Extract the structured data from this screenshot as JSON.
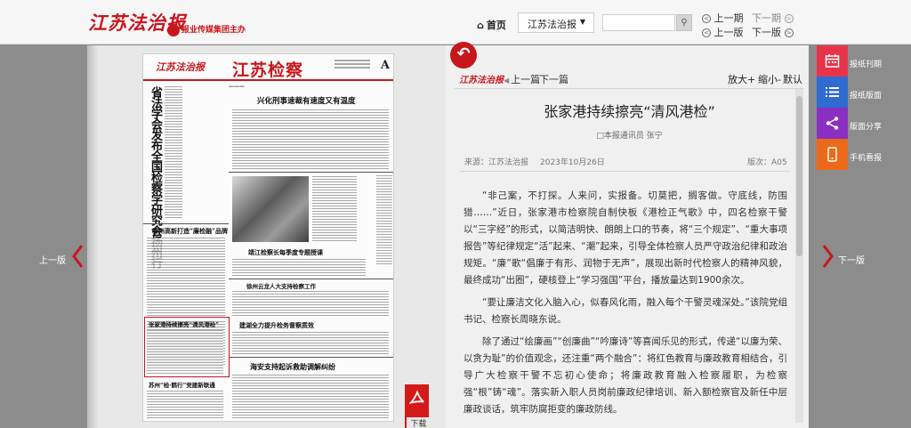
{
  "header": {
    "logo": "江苏法治报",
    "slogan": "报业传媒集团主办",
    "home_label": "首页",
    "paper_select": "江苏法治报",
    "search_placeholder": "",
    "prev_issue": "上一期",
    "next_issue": "下一期",
    "prev_page": "上一版",
    "next_page": "下一版"
  },
  "newspaper": {
    "masthead_logo": "江苏法治报",
    "section": "江苏检察",
    "edition": "A",
    "left_vertical_head": "省法学会发布全国检察学研究会扬州行",
    "head_1": "兴化刑事速裁有速度又有温度",
    "head_2": "泰州高新打造“廉检融”品牌",
    "head_3": "靖江检察长每季度专题授课",
    "head_4": "徐州云龙人大支持检察工作",
    "head_5": "建湖全力提升检务督察质效",
    "head_6": "张家港持续擦亮“清风港检”",
    "head_7": "海安支持起诉救助调解纠纷",
    "head_8": "苏州“检·鹤行”党建新联通",
    "download_label": "下载"
  },
  "article": {
    "logo": "江苏法治报",
    "prev_article": "上一篇",
    "next_article": "下一篇",
    "zoom_in": "放大+",
    "zoom_out": "缩小-",
    "zoom_reset": "默认",
    "title": "张家港持续擦亮“清风港检”",
    "byline": "□本报通讯员 张宁",
    "source": "来源：江苏法治报",
    "date": "2023年10月26日",
    "page_label": "版次：A05",
    "paragraphs": [
      "“非己案，不打探。人来问，实报备。切莫把，搁客做。守底线，防围猎……”近日，张家港市检察院自制快板《港检正气歌》中，四名检察干警以“三字经”的形式，以简洁明快、朗朗上口的节奏，将“三个规定”、“重大事项报告”等纪律规定“活”起来、“潮”起来，引导全体检察人员严守政治纪律和政治规矩。“廉”歌“倡廉于有形、润物于无声”，展现出新时代检察人的精神风貌，最终成功“出圈”，硬核登上“学习强国”平台，播放量达到1900余次。",
      "“要让廉洁文化入脑入心，似春风化雨，融入每个干警灵魂深处。”该院党组书记、检察长周晓东说。",
      "除了通过“绘廉画”“创廉曲”“吟廉诗”等喜闻乐见的形式，传递“以廉为荣、以贪为耻”的价值观念，还注重“两个融合”：将红色教育与廉政教育相结合，引导广大检察干警不忘初心使命；将廉政教育融入检察履职，为检察强“根”铸“魂”。落实新入职人员岗前廉政纪律培训、新入额检察官及新任中层廉政谈话，筑牢防腐拒变的廉政防线。"
    ]
  },
  "edge_nav": {
    "prev": "上一版",
    "next": "下一版"
  },
  "toolbar": {
    "items": [
      {
        "label": "报纸刊期",
        "icon": "calendar-icon",
        "color": "#e8344a"
      },
      {
        "label": "报纸版面",
        "icon": "list-icon",
        "color": "#2f6bd0"
      },
      {
        "label": "版面分享",
        "icon": "share-icon",
        "color": "#8a2fc0"
      },
      {
        "label": "手机看报",
        "icon": "mobile-icon",
        "color": "#ea6a1a"
      }
    ]
  },
  "colors": {
    "brand_red": "#c8161d",
    "background": "#8c8c8c"
  }
}
